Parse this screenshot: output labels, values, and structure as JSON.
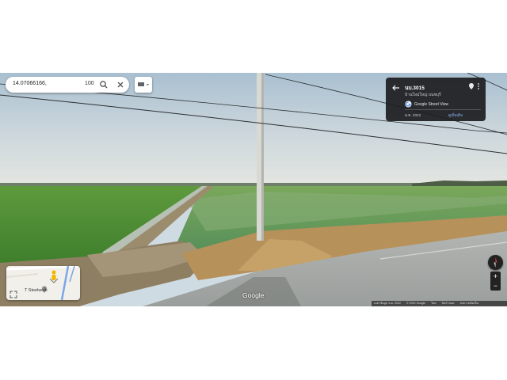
{
  "search": {
    "query": "14.07066166,",
    "value": "100",
    "search_icon": "search-icon",
    "close_icon": "close-icon"
  },
  "layers_button": {
    "icon": "layers-icon"
  },
  "info_card": {
    "title": "นบ.3015",
    "subtitle": "บ้านใหม่ใหญ่ บนชบุรี",
    "source": "Google Street View",
    "date": "ม.ค. 2022",
    "more_link": "ดูเพิ่มเติม"
  },
  "minimap": {
    "label": "T Steelwork"
  },
  "controls": {
    "zoom_in": "+",
    "zoom_out": "−"
  },
  "branding": {
    "google_logo": "Google"
  },
  "attribution": {
    "items": [
      "เมตาข้อมูล ข.ค. 2022",
      "© 2022 Google",
      "ไทย",
      "ข้อกำหนด",
      "ส่งความคิดเห็น"
    ]
  },
  "colors": {
    "sky_top": "#a9c0d1",
    "sky_horizon": "#e4e6e1",
    "field_green": "#4d8d34",
    "water_field": "#5d8f6f",
    "road": "#a4a8a6",
    "card_bg": "#1c1c1e",
    "accent_blue": "#8ab4f8"
  }
}
